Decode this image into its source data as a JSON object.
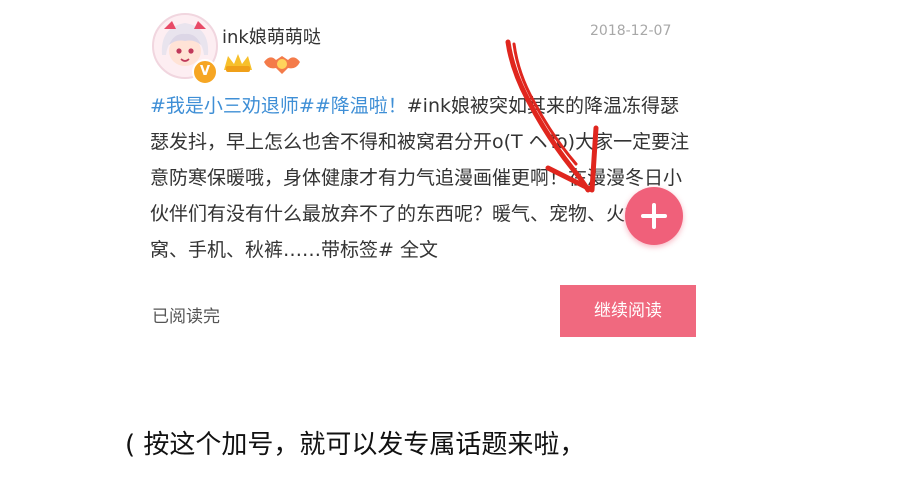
{
  "post": {
    "username": "ink娘萌萌哒",
    "date": "2018-12-07",
    "avatar_icon": "avatar-anime-girl",
    "verified_icon": "verified-v-badge",
    "verified_mark": "V",
    "level_badge_icon": "vip-level-badge",
    "medal_badge_icon": "medal-badge",
    "topic_1": "#我是小三劝退师#",
    "topic_2": "#降温啦！",
    "body_line_1": "#ink娘被突如其来的降温冻",
    "body_rest": "得瑟瑟发抖，早上怎么也舍不得和被窝君分开o(T ヘTo)大家一定要注意防寒保暖哦，身体健康才有力气追漫画催更啊！在漫漫冬日小伙伴们有没有什么最放弃不了的东西呢？暖气、宠物、火锅、被窝、手机、秋裤……带标签#  全文",
    "read_done": "已阅读完",
    "continue_button": "继续阅读"
  },
  "fab": {
    "icon": "plus-icon",
    "color": "#f0607a"
  },
  "annotation": {
    "arrow_icon": "red-hand-drawn-arrow",
    "arrow_color": "#e0261e",
    "caption": "( 按这个加号，就可以发专属话题来啦，"
  },
  "colors": {
    "topic_link": "#3f8fd6",
    "continue_button_bg": "#f0697f"
  }
}
